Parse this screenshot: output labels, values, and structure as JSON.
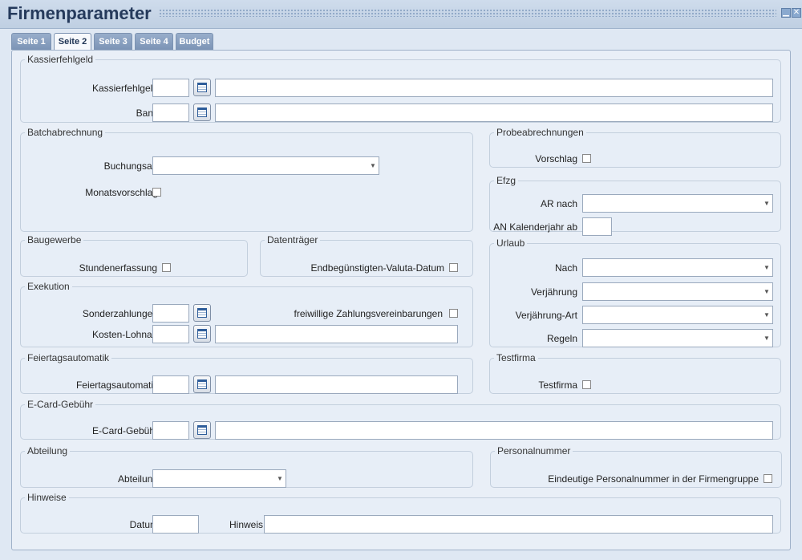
{
  "window": {
    "title": "Firmenparameter",
    "minimize_symbol": "▁",
    "close_symbol": "✕"
  },
  "tabs": [
    {
      "label": "Seite 1"
    },
    {
      "label": "Seite 2"
    },
    {
      "label": "Seite 3"
    },
    {
      "label": "Seite 4"
    },
    {
      "label": "Budget"
    }
  ],
  "kassierfehlgeld": {
    "legend": "Kassierfehlgeld",
    "kassierfehlgeld_label": "Kassierfehlgeld",
    "bank_label": "Bank"
  },
  "batchabrechnung": {
    "legend": "Batchabrechnung",
    "buchungsart_label": "Buchungsart",
    "monatsvorschlag_label": "Monatsvorschlag"
  },
  "probeabrechnungen": {
    "legend": "Probeabrechnungen",
    "vorschlag_label": "Vorschlag"
  },
  "efzg": {
    "legend": "Efzg",
    "ar_nach_label": "AR nach",
    "an_kalenderjahr_label": "AN Kalenderjahr ab"
  },
  "baugewerbe": {
    "legend": "Baugewerbe",
    "stundenerfassung_label": "Stundenerfassung"
  },
  "datentraeger": {
    "legend": "Datenträger",
    "endbeguenstigten_label": "Endbegünstigten-Valuta-Datum"
  },
  "urlaub": {
    "legend": "Urlaub",
    "nach_label": "Nach",
    "verjaehrung_label": "Verjährung",
    "verjaehrung_art_label": "Verjährung-Art",
    "regeln_label": "Regeln"
  },
  "exekution": {
    "legend": "Exekution",
    "sonderzahlungen_label": "Sonderzahlungen",
    "kosten_lohnart_label": "Kosten-Lohnart",
    "freiwillige_label": "freiwillige Zahlungsvereinbarungen"
  },
  "feiertagsautomatik": {
    "legend": "Feiertagsautomatik",
    "feiertagsautomatik_label": "Feiertagsautomatik"
  },
  "testfirma": {
    "legend": "Testfirma",
    "testfirma_label": "Testfirma"
  },
  "ecard": {
    "legend": "E-Card-Gebühr",
    "ecard_label": "E-Card-Gebühr"
  },
  "abteilung": {
    "legend": "Abteilung",
    "abteilung_label": "Abteilung"
  },
  "personalnummer": {
    "legend": "Personalnummer",
    "eindeutige_label": "Eindeutige Personalnummer in der Firmengruppe"
  },
  "hinweise": {
    "legend": "Hinweise",
    "datum_label": "Datum",
    "hinweis_label": "Hinweis"
  },
  "icons": {
    "calendar": "calendar-icon",
    "dropdown": "chevron-down-icon",
    "arrow_glyph": "▼"
  }
}
